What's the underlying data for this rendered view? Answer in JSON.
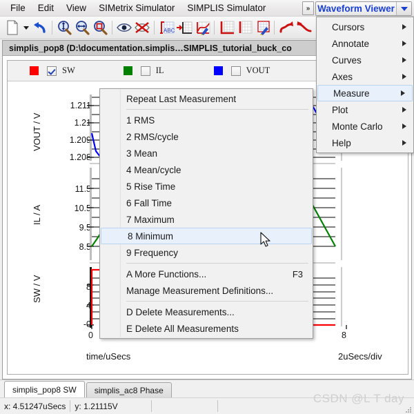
{
  "menubar": {
    "items": [
      {
        "label": "File"
      },
      {
        "label": "Edit"
      },
      {
        "label": "View"
      },
      {
        "label": "SIMetrix Simulator"
      },
      {
        "label": "SIMPLIS Simulator"
      }
    ],
    "overflow_label": "»",
    "combo_label": "Waveform Viewer"
  },
  "toolbar": {
    "buttons": [
      {
        "name": "new-document-icon",
        "tip": "New"
      },
      {
        "name": "dropdown-arrow-icon",
        "tip": "More"
      },
      {
        "name": "undo-icon",
        "tip": "Undo"
      },
      {
        "name": "zoom-vertical-icon",
        "tip": "Zoom Vertical"
      },
      {
        "name": "zoom-horizontal-icon",
        "tip": "Zoom Horizontal"
      },
      {
        "name": "zoom-box-icon",
        "tip": "Zoom Box"
      },
      {
        "name": "eye-icon",
        "tip": "Show"
      },
      {
        "name": "eye-off-icon",
        "tip": "Hide"
      },
      {
        "name": "add-text-icon",
        "tip": "Add Text"
      },
      {
        "name": "add-axis-icon",
        "tip": "Add Axis"
      },
      {
        "name": "edit-curve-icon",
        "tip": "Edit Curve"
      },
      {
        "name": "grid-axes-icon",
        "tip": "Axes"
      },
      {
        "name": "grid-icon",
        "tip": "Grid"
      },
      {
        "name": "edit-grid-icon",
        "tip": "Edit Grid"
      },
      {
        "name": "curve-forward-icon",
        "tip": "Next Curve"
      },
      {
        "name": "curve-back-icon",
        "tip": "Previous Curve"
      }
    ]
  },
  "plot": {
    "title": "simplis_pop8 (D:\\documentation.simplis…SIMPLIS_tutorial_buck_co",
    "legend": [
      {
        "label": "SW",
        "color": "#ff0000",
        "checked": true
      },
      {
        "label": "IL",
        "color": "#008000",
        "checked": false
      },
      {
        "label": "VOUT",
        "color": "#0000ff",
        "checked": false
      }
    ],
    "x_axis_label": "time/uSecs",
    "x_axis_scale": "2uSecs/div",
    "x_ticks": [
      {
        "value": 0,
        "label": "0"
      },
      {
        "value": 8,
        "label": "8"
      }
    ],
    "panes": [
      {
        "name": "VOUT",
        "axis_title": "VOUT / V",
        "ticks": [
          "1.211",
          "1.21",
          "1.209",
          "1.208"
        ],
        "color": "#0000ff"
      },
      {
        "name": "IL",
        "axis_title": "IL / A",
        "ticks": [
          "11.5",
          "10.5",
          "9.5",
          "8.5"
        ],
        "color": "#008000"
      },
      {
        "name": "SW",
        "axis_title": "SW / V",
        "ticks": [
          "8",
          "4",
          "-0"
        ],
        "color": "#ff0000"
      }
    ]
  },
  "main_menu": {
    "items": [
      {
        "label": "Cursors",
        "submenu": true
      },
      {
        "label": "Annotate",
        "submenu": true
      },
      {
        "label": "Curves",
        "submenu": true
      },
      {
        "label": "Axes",
        "submenu": true
      },
      {
        "label": "Measure",
        "submenu": true,
        "selected": true
      },
      {
        "label": "Plot",
        "submenu": true
      },
      {
        "label": "Monte Carlo",
        "submenu": true
      },
      {
        "label": "Help",
        "submenu": true
      }
    ]
  },
  "measure_menu": {
    "items": [
      {
        "label": "Repeat Last Measurement"
      },
      {
        "separator": true
      },
      {
        "label": "1 RMS"
      },
      {
        "label": "2 RMS/cycle"
      },
      {
        "label": "3 Mean"
      },
      {
        "label": "4 Mean/cycle"
      },
      {
        "label": "5 Rise Time"
      },
      {
        "label": "6 Fall Time"
      },
      {
        "label": "7 Maximum"
      },
      {
        "label": "8 Minimum",
        "selected": true
      },
      {
        "label": "9 Frequency"
      },
      {
        "separator": true
      },
      {
        "label": "A More Functions...",
        "accel": "F3"
      },
      {
        "label": "Manage Measurement Definitions..."
      },
      {
        "separator": true
      },
      {
        "label": "D Delete Measurements..."
      },
      {
        "label": "E Delete All Measurements"
      }
    ]
  },
  "tabs": [
    {
      "label": "simplis_pop8 SW",
      "active": true
    },
    {
      "label": "simplis_ac8 Phase",
      "active": false
    }
  ],
  "statusbar": {
    "x_readout": "x: 4.51247uSecs",
    "y_readout": "y: 1.21115V",
    "cell3": "",
    "cell4": "",
    "watermark": "CSDN @L T day"
  },
  "chart_data": {
    "type": "line",
    "title": "simplis_pop8 SW",
    "xlabel": "time/uSecs",
    "xlim": [
      0,
      10
    ],
    "x_ticks": [
      0,
      8
    ],
    "x_per_div": 2,
    "series": [
      {
        "name": "VOUT",
        "ylabel": "VOUT / V",
        "color": "#0000ff",
        "ylim": [
          1.2075,
          1.2115
        ],
        "y_ticks": [
          1.211,
          1.21,
          1.209,
          1.208
        ],
        "x": [
          0.0,
          0.35,
          0.8,
          2.2,
          3.0,
          3.4,
          4.3,
          5.2,
          6.0,
          6.4,
          7.3,
          8.2,
          9.0,
          9.4,
          10.0
        ],
        "y": [
          1.2095,
          1.208,
          1.2086,
          1.2112,
          1.2103,
          1.208,
          1.2086,
          1.2112,
          1.2103,
          1.208,
          1.2086,
          1.2112,
          1.2103,
          1.208,
          1.2086
        ]
      },
      {
        "name": "IL",
        "ylabel": "IL / A",
        "color": "#008000",
        "ylim": [
          8.1,
          12.0
        ],
        "y_ticks": [
          11.5,
          10.5,
          9.5,
          8.5
        ],
        "x": [
          0.0,
          1.1,
          1.6,
          3.2,
          4.3,
          4.8,
          6.4,
          7.4,
          7.9,
          9.5,
          10.0
        ],
        "y": [
          8.45,
          11.55,
          11.75,
          8.35,
          11.55,
          11.75,
          8.35,
          11.55,
          11.75,
          8.35,
          9.3
        ]
      },
      {
        "name": "SW",
        "ylabel": "SW / V",
        "color": "#ff0000",
        "ylim": [
          -0.6,
          11.5
        ],
        "y_ticks": [
          8,
          4,
          0
        ],
        "x": [
          0.0,
          0.05,
          0.6,
          0.65,
          4.0,
          4.05,
          4.6,
          4.65,
          7.2,
          7.25,
          7.8,
          7.85,
          10.0
        ],
        "y": [
          0,
          10.5,
          10.5,
          0,
          0,
          10.5,
          10.5,
          0,
          0,
          10.5,
          10.5,
          0,
          0
        ]
      }
    ]
  }
}
